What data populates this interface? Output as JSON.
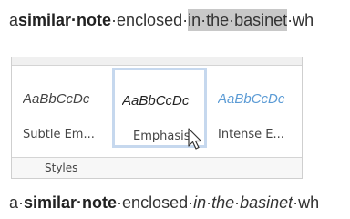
{
  "document": {
    "top_line": {
      "prefix": "a",
      "bold": "similar·note",
      "middle": "·enclosed·",
      "highlighted": "in·the·basinet",
      "suffix": "·wh"
    },
    "bottom_line": {
      "prefix": "a·",
      "bold": "similar·note",
      "middle": "·enclosed·",
      "italic": "in·the·basinet",
      "suffix": "·wh"
    }
  },
  "ribbon": {
    "group_label": "Styles",
    "styles": [
      {
        "sample": "AaBbCcDc",
        "name": "Subtle Em..."
      },
      {
        "sample": "AaBbCcDc",
        "name": "Emphasis"
      },
      {
        "sample": "AaBbCcDc",
        "name": "Intense E..."
      }
    ],
    "hovered_style": "Emphasis"
  },
  "colors": {
    "highlight": "#c8c8c8",
    "hover_border": "#c6d8ee",
    "intense_emphasis": "#5b9bd5"
  }
}
